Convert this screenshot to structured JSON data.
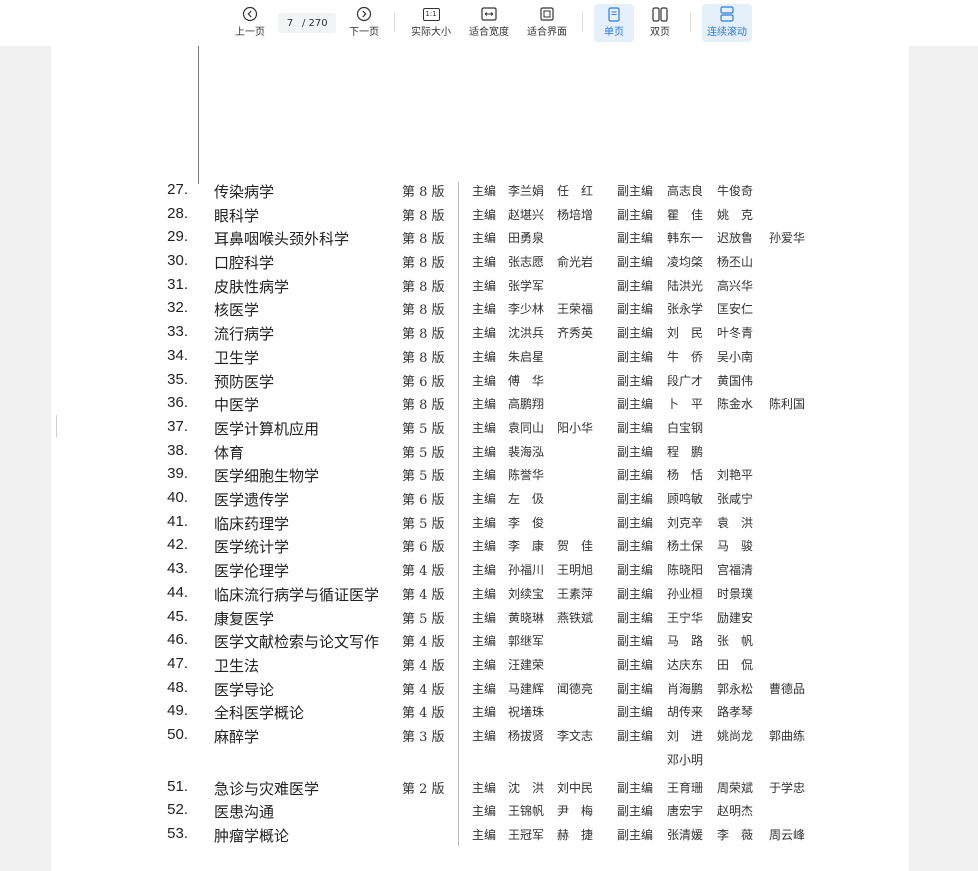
{
  "toolbar": {
    "prev_label": "上一页",
    "page_current": "7",
    "page_total": "/ 270",
    "next_label": "下一页",
    "actual_size_label": "实际大小",
    "actual_size_badge": "1:1",
    "fit_width_label": "适合宽度",
    "fit_page_label": "适合界面",
    "single_page_label": "单页",
    "double_page_label": "双页",
    "continuous_scroll_label": "连续滚动",
    "accent_color": "#2a7be4"
  },
  "books": [
    {
      "num": "27.",
      "title": "传染病学",
      "edition": "第 8 版",
      "role": "主编",
      "editors": [
        "李兰娟",
        "任　红"
      ],
      "role2": "副主编",
      "deputies": [
        "高志良",
        "牛俊奇"
      ]
    },
    {
      "num": "28.",
      "title": "眼科学",
      "edition": "第 8 版",
      "role": "主编",
      "editors": [
        "赵堪兴",
        "杨培增"
      ],
      "role2": "副主编",
      "deputies": [
        "瞿　佳",
        "姚　克"
      ]
    },
    {
      "num": "29.",
      "title": "耳鼻咽喉头颈外科学",
      "edition": "第 8 版",
      "role": "主编",
      "editors": [
        "田勇泉",
        ""
      ],
      "role2": "副主编",
      "deputies": [
        "韩东一",
        "迟放鲁",
        "孙爱华"
      ]
    },
    {
      "num": "30.",
      "title": "口腔科学",
      "edition": "第 8 版",
      "role": "主编",
      "editors": [
        "张志愿",
        "俞光岩"
      ],
      "role2": "副主编",
      "deputies": [
        "凌均棨",
        "杨丕山"
      ]
    },
    {
      "num": "31.",
      "title": "皮肤性病学",
      "edition": "第 8 版",
      "role": "主编",
      "editors": [
        "张学军",
        ""
      ],
      "role2": "副主编",
      "deputies": [
        "陆洪光",
        "高兴华"
      ]
    },
    {
      "num": "32.",
      "title": "核医学",
      "edition": "第 8 版",
      "role": "主编",
      "editors": [
        "李少林",
        "王荣福"
      ],
      "role2": "副主编",
      "deputies": [
        "张永学",
        "匡安仁"
      ]
    },
    {
      "num": "33.",
      "title": "流行病学",
      "edition": "第 8 版",
      "role": "主编",
      "editors": [
        "沈洪兵",
        "齐秀英"
      ],
      "role2": "副主编",
      "deputies": [
        "刘　民",
        "叶冬青"
      ]
    },
    {
      "num": "34.",
      "title": "卫生学",
      "edition": "第 8 版",
      "role": "主编",
      "editors": [
        "朱启星",
        ""
      ],
      "role2": "副主编",
      "deputies": [
        "牛　侨",
        "吴小南"
      ]
    },
    {
      "num": "35.",
      "title": "预防医学",
      "edition": "第 6 版",
      "role": "主编",
      "editors": [
        "傅　华",
        ""
      ],
      "role2": "副主编",
      "deputies": [
        "段广才",
        "黄国伟"
      ]
    },
    {
      "num": "36.",
      "title": "中医学",
      "edition": "第 8 版",
      "role": "主编",
      "editors": [
        "高鹏翔",
        ""
      ],
      "role2": "副主编",
      "deputies": [
        "卜　平",
        "陈金水",
        "陈利国"
      ]
    },
    {
      "num": "37.",
      "title": "医学计算机应用",
      "edition": "第 5 版",
      "role": "主编",
      "editors": [
        "袁同山",
        "阳小华"
      ],
      "role2": "副主编",
      "deputies": [
        "白宝钢"
      ]
    },
    {
      "num": "38.",
      "title": "体育",
      "edition": "第 5 版",
      "role": "主编",
      "editors": [
        "裴海泓",
        ""
      ],
      "role2": "副主编",
      "deputies": [
        "程　鹏"
      ]
    },
    {
      "num": "39.",
      "title": "医学细胞生物学",
      "edition": "第 5 版",
      "role": "主编",
      "editors": [
        "陈誉华",
        ""
      ],
      "role2": "副主编",
      "deputies": [
        "杨　恬",
        "刘艳平"
      ]
    },
    {
      "num": "40.",
      "title": "医学遗传学",
      "edition": "第 6 版",
      "role": "主编",
      "editors": [
        "左　伋",
        ""
      ],
      "role2": "副主编",
      "deputies": [
        "顾鸣敏",
        "张咸宁"
      ]
    },
    {
      "num": "41.",
      "title": "临床药理学",
      "edition": "第 5 版",
      "role": "主编",
      "editors": [
        "李　俊",
        ""
      ],
      "role2": "副主编",
      "deputies": [
        "刘克辛",
        "袁　洪"
      ]
    },
    {
      "num": "42.",
      "title": "医学统计学",
      "edition": "第 6 版",
      "role": "主编",
      "editors": [
        "李　康",
        "贺　佳"
      ],
      "role2": "副主编",
      "deputies": [
        "杨土保",
        "马　骏"
      ]
    },
    {
      "num": "43.",
      "title": "医学伦理学",
      "edition": "第 4 版",
      "role": "主编",
      "editors": [
        "孙福川",
        "王明旭"
      ],
      "role2": "副主编",
      "deputies": [
        "陈晓阳",
        "宫福清"
      ]
    },
    {
      "num": "44.",
      "title": "临床流行病学与循证医学",
      "edition": "第 4 版",
      "role": "主编",
      "editors": [
        "刘续宝",
        "王素萍"
      ],
      "role2": "副主编",
      "deputies": [
        "孙业桓",
        "时景璞"
      ]
    },
    {
      "num": "45.",
      "title": "康复医学",
      "edition": "第 5 版",
      "role": "主编",
      "editors": [
        "黄晓琳",
        "燕铁斌"
      ],
      "role2": "副主编",
      "deputies": [
        "王宁华",
        "励建安"
      ]
    },
    {
      "num": "46.",
      "title": "医学文献检索与论文写作",
      "edition": "第 4 版",
      "role": "主编",
      "editors": [
        "郭继军",
        ""
      ],
      "role2": "副主编",
      "deputies": [
        "马　路",
        "张　帆"
      ]
    },
    {
      "num": "47.",
      "title": "卫生法",
      "edition": "第 4 版",
      "role": "主编",
      "editors": [
        "汪建荣",
        ""
      ],
      "role2": "副主编",
      "deputies": [
        "达庆东",
        "田　侃"
      ]
    },
    {
      "num": "48.",
      "title": "医学导论",
      "edition": "第 4 版",
      "role": "主编",
      "editors": [
        "马建辉",
        "闻德亮"
      ],
      "role2": "副主编",
      "deputies": [
        "肖海鹏",
        "郭永松",
        "曹德品"
      ]
    },
    {
      "num": "49.",
      "title": "全科医学概论",
      "edition": "第 4 版",
      "role": "主编",
      "editors": [
        "祝墡珠",
        ""
      ],
      "role2": "副主编",
      "deputies": [
        "胡传来",
        "路孝琴"
      ]
    },
    {
      "num": "50.",
      "title": "麻醉学",
      "edition": "第 3 版",
      "role": "主编",
      "editors": [
        "杨拔贤",
        "李文志"
      ],
      "role2": "副主编",
      "deputies": [
        "刘　进",
        "姚尚龙",
        "郭曲练"
      ],
      "extra_deputy": "邓小明"
    },
    {
      "num": "51.",
      "title": "急诊与灾难医学",
      "edition": "第 2 版",
      "role": "主编",
      "editors": [
        "沈　洪",
        "刘中民"
      ],
      "role2": "副主编",
      "deputies": [
        "王育珊",
        "周荣斌",
        "于学忠"
      ]
    },
    {
      "num": "52.",
      "title": "医患沟通",
      "edition": "",
      "role": "主编",
      "editors": [
        "王锦帆",
        "尹　梅"
      ],
      "role2": "副主编",
      "deputies": [
        "唐宏宇",
        "赵明杰"
      ]
    },
    {
      "num": "53.",
      "title": "肿瘤学概论",
      "edition": "",
      "role": "主编",
      "editors": [
        "王冠军",
        "赫　捷"
      ],
      "role2": "副主编",
      "deputies": [
        "张清媛",
        "李　薇",
        "周云峰"
      ]
    }
  ]
}
